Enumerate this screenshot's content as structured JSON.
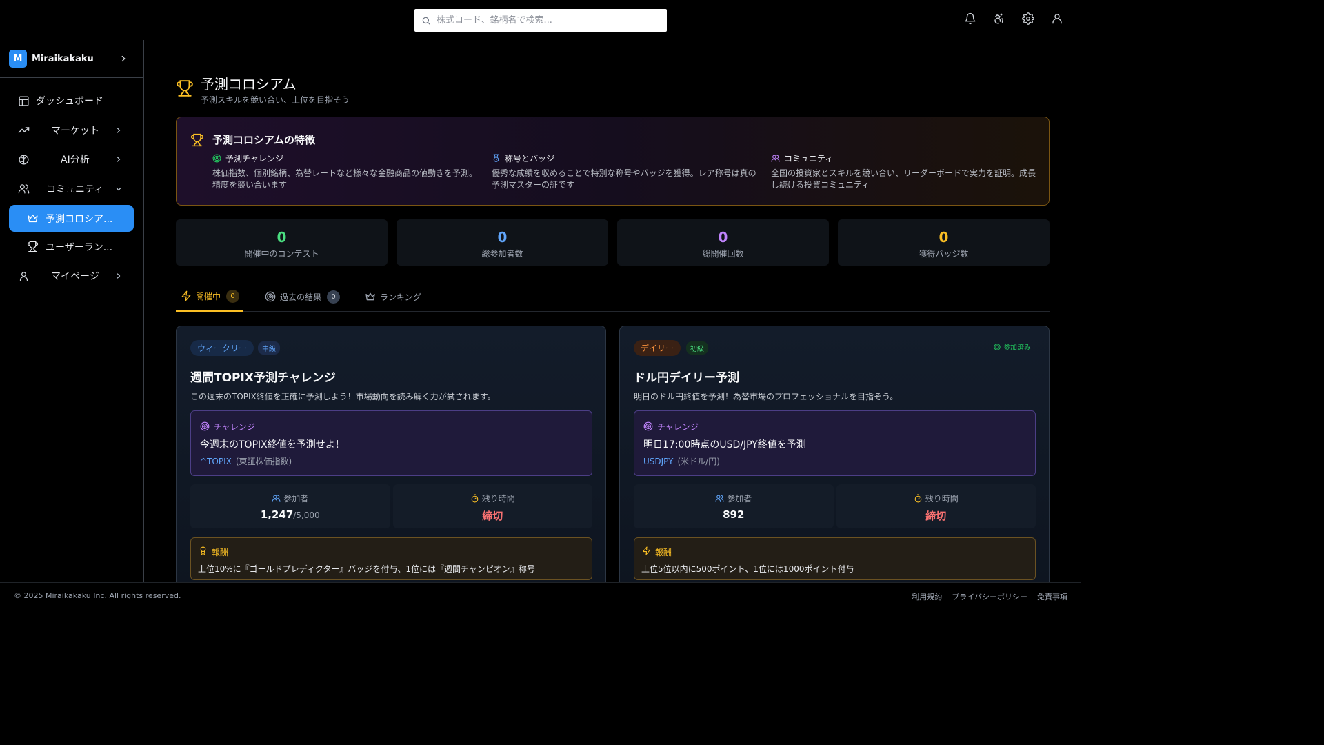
{
  "search": {
    "placeholder": "株式コード、銘柄名で検索..."
  },
  "brand": {
    "logo_letter": "M",
    "name": "Miraikakaku"
  },
  "sidebar": {
    "items": [
      {
        "label": "ダッシュボード"
      },
      {
        "label": "マーケット"
      },
      {
        "label": "AI分析"
      },
      {
        "label": "コミュニティ"
      },
      {
        "label": "予測コロシア..."
      },
      {
        "label": "ユーザーラン..."
      },
      {
        "label": "マイページ"
      }
    ]
  },
  "page": {
    "title": "予測コロシアム",
    "subtitle": "予測スキルを競い合い、上位を目指そう"
  },
  "features": {
    "title": "予測コロシアムの特徴",
    "items": [
      {
        "title": "予測チャレンジ",
        "desc": "株価指数、個別銘柄、為替レートなど様々な金融商品の値動きを予測。精度を競い合います",
        "icon": "target-icon",
        "color": "#22c55e"
      },
      {
        "title": "称号とバッジ",
        "desc": "優秀な成績を収めることで特別な称号やバッジを獲得。レア称号は真の予測マスターの証です",
        "icon": "medal-icon",
        "color": "#60a5fa"
      },
      {
        "title": "コミュニティ",
        "desc": "全国の投資家とスキルを競い合い、リーダーボードで実力を証明。成長し続ける投資コミュニティ",
        "icon": "users-icon",
        "color": "#c084fc"
      }
    ]
  },
  "stats": [
    {
      "value": "0",
      "label": "開催中のコンテスト",
      "color": "#4ade80"
    },
    {
      "value": "0",
      "label": "総参加者数",
      "color": "#60a5fa"
    },
    {
      "value": "0",
      "label": "総開催回数",
      "color": "#c084fc"
    },
    {
      "value": "0",
      "label": "獲得バッジ数",
      "color": "#fbbf24"
    }
  ],
  "tabs": [
    {
      "label": "開催中",
      "count": "0"
    },
    {
      "label": "過去の結果",
      "count": "0"
    },
    {
      "label": "ランキング"
    }
  ],
  "contests": [
    {
      "period": "ウィークリー",
      "level": "中級",
      "title": "週間TOPIX予測チャレンジ",
      "desc": "この週末のTOPIX終値を正確に予測しよう！市場動向を読み解く力が試されます。",
      "challenge_label": "チャレンジ",
      "challenge_text": "今週末のTOPIX終値を予測せよ！",
      "symbol": "^TOPIX",
      "symbol_name": "(東証株価指数)",
      "participants_label": "参加者",
      "participants": "1,247",
      "participants_max": "/5,000",
      "time_label": "残り時間",
      "time_value": "締切",
      "reward_label": "報酬",
      "reward_text": "上位10%に『ゴールドプレディクター』バッジを付与、1位には『週間チャンピオン』称号"
    },
    {
      "period": "デイリー",
      "level": "初級",
      "joined": "参加済み",
      "title": "ドル円デイリー予測",
      "desc": "明日のドル円終値を予測！為替市場のプロフェッショナルを目指そう。",
      "challenge_label": "チャレンジ",
      "challenge_text": "明日17:00時点のUSD/JPY終値を予測",
      "symbol": "USDJPY",
      "symbol_name": "(米ドル/円)",
      "participants_label": "参加者",
      "participants": "892",
      "time_label": "残り時間",
      "time_value": "締切",
      "reward_label": "報酬",
      "reward_text": "上位5位以内に500ポイント、1位には1000ポイント付与"
    }
  ],
  "footer": {
    "copyright": "© 2025 Miraikakaku Inc. All rights reserved.",
    "links": [
      "利用規約",
      "プライバシーポリシー",
      "免責事項"
    ]
  }
}
